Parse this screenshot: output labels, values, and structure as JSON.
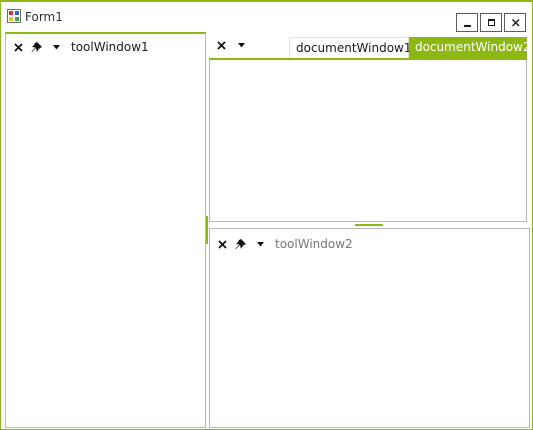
{
  "window": {
    "title": "Form1",
    "buttons": [
      "minimize",
      "maximize",
      "close"
    ]
  },
  "tool_windows": [
    {
      "title": "toolWindow1",
      "state": "active",
      "icons": [
        "close-icon",
        "pin-icon",
        "dropdown-icon"
      ]
    },
    {
      "title": "toolWindow2",
      "state": "inactive",
      "icons": [
        "close-icon",
        "pin-icon",
        "dropdown-icon"
      ]
    }
  ],
  "document_tabs": [
    {
      "label": "documentWindow1",
      "selected": false
    },
    {
      "label": "documentWindow2",
      "selected": true
    }
  ],
  "colors": {
    "accent": "#8db812",
    "border": "#b9b9b9",
    "inactive_text": "#777777"
  }
}
